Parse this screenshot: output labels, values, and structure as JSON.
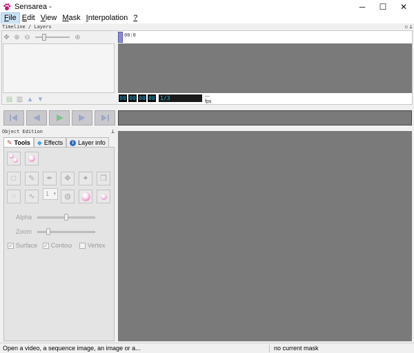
{
  "window": {
    "title": "Sensarea -",
    "icon": "paw-icon",
    "controls": {
      "minimize": "─",
      "maximize": "☐",
      "close": "✕"
    }
  },
  "menu": {
    "items": [
      {
        "label": "File",
        "mnemonic": "F"
      },
      {
        "label": "Edit",
        "mnemonic": "E"
      },
      {
        "label": "View",
        "mnemonic": "V"
      },
      {
        "label": "Mask",
        "mnemonic": "M"
      },
      {
        "label": "Interpolation",
        "mnemonic": "I"
      },
      {
        "label": "?",
        "mnemonic": "?"
      }
    ]
  },
  "timeline": {
    "dock_title": "Timeline / Layers",
    "ruler_label": "00:0",
    "time_fields": [
      "00",
      "00",
      "00",
      "00"
    ],
    "frame_counter": "1/3",
    "fps_label": "--- fps"
  },
  "object_edition": {
    "dock_title": "Object Edition",
    "tabs": [
      {
        "label": "Tools",
        "icon": "brush-icon",
        "active": true
      },
      {
        "label": "Effects",
        "icon": "diamond-icon",
        "active": false
      },
      {
        "label": "Layer info",
        "icon": "info-icon",
        "active": false
      }
    ],
    "combo_value": "1",
    "alpha_label": "Alpha",
    "zoom_label": "Zoom",
    "checkboxes": [
      {
        "label": "Surface",
        "checked": true
      },
      {
        "label": "Contour",
        "checked": true
      },
      {
        "label": "Vertex",
        "checked": false
      }
    ]
  },
  "status": {
    "left": "Open a video, a sequence image, an image or a...",
    "right": "no current mask"
  },
  "colors": {
    "canvas": "#7a7a7a",
    "timecode_text": "#27b4e6",
    "active_menu": "#cce4f7"
  }
}
